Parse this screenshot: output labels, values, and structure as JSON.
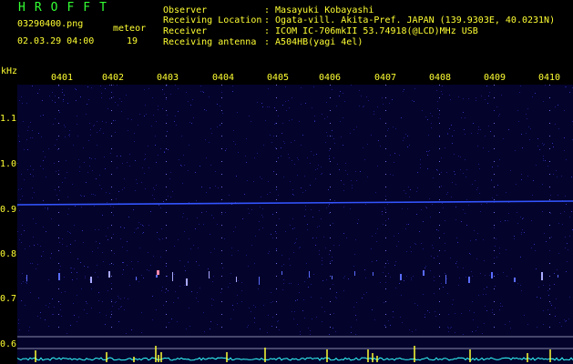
{
  "header": {
    "app_title": "HROFFT",
    "filename": "03290400.png",
    "meteor_label": "meteor",
    "datetime": "02.03.29 04:00",
    "meteor_count": "19"
  },
  "meta": [
    {
      "label": "Observer",
      "value": ": Masayuki Kobayashi"
    },
    {
      "label": "Receiving Location",
      "value": ": Ogata-vill. Akita-Pref. JAPAN (139.9303E, 40.0231N)"
    },
    {
      "label": "Receiver",
      "value": ": ICOM IC-706mkII 53.74918(@LCD)MHz USB"
    },
    {
      "label": "Receiving antenna",
      "value": ": A504HB(yagi 4el)"
    }
  ],
  "axis": {
    "unit_label": "kHz",
    "time_ticks": [
      "0401",
      "0402",
      "0403",
      "0404",
      "0405",
      "0406",
      "0407",
      "0408",
      "0409",
      "0410"
    ],
    "freq_ticks": [
      "1.1",
      "1.0",
      "0.9",
      "0.8",
      "0.7",
      "0.6"
    ]
  },
  "colors": {
    "text_yellow": "#ffff33",
    "text_green": "#33ff33",
    "background": "#000000",
    "spectrogram_bg": "#04032c",
    "carrier_line": "#3355ff",
    "noise_trace": "#33ffff",
    "meteor_peak": "#ffff33"
  }
}
